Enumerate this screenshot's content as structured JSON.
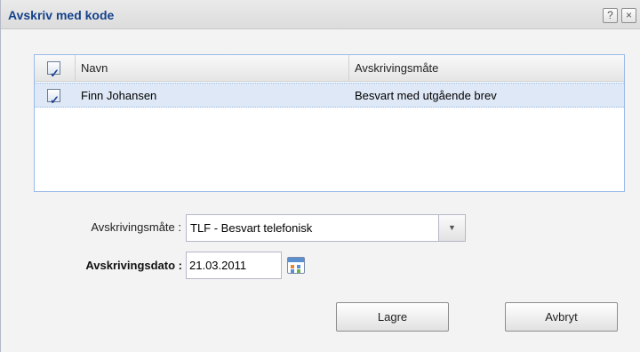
{
  "dialog": {
    "title": "Avskriv med kode",
    "help_icon": "?",
    "close_icon": "×"
  },
  "grid": {
    "columns": [
      "Navn",
      "Avskrivingsmåte"
    ],
    "header_checked": true,
    "rows": [
      {
        "checked": true,
        "name": "Finn Johansen",
        "mode": "Besvart med utgående brev"
      }
    ]
  },
  "form": {
    "mode_label": "Avskrivingsmåte :",
    "mode_value": "TLF - Besvart telefonisk",
    "date_label": "Avskrivingsdato :",
    "date_value": "21.03.2011"
  },
  "buttons": {
    "save": "Lagre",
    "cancel": "Avbryt"
  },
  "icons": {
    "checkbox": "check-icon",
    "dropdown": "chevron-down-icon",
    "calendar": "calendar-icon"
  }
}
